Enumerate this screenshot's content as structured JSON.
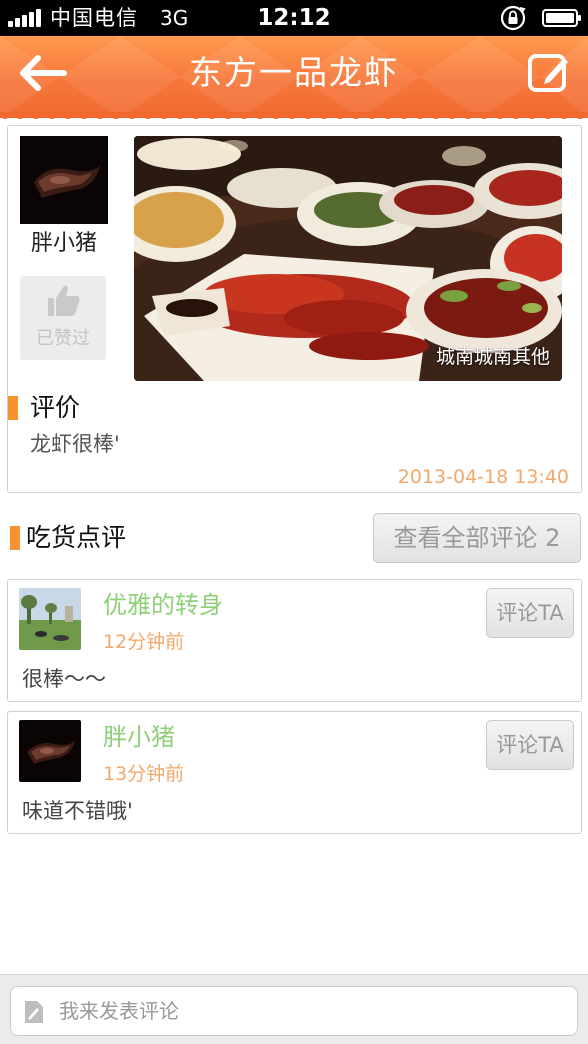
{
  "status_bar": {
    "carrier": "中国电信",
    "network": "3G",
    "time": "12:12"
  },
  "nav": {
    "title": "东方一品龙虾",
    "back_icon": "arrow-left-icon",
    "edit_icon": "edit-icon",
    "color": "#f7773b"
  },
  "post": {
    "author": "胖小猪",
    "like_label": "已赞过",
    "photo_caption": "城南城南其他",
    "review_heading": "评价",
    "review_text": "龙虾很棒'",
    "timestamp": "2013-04-18 13:40"
  },
  "comments_section": {
    "heading": "吃货点评",
    "view_all_label": "查看全部评论 2"
  },
  "comments": [
    {
      "name": "优雅的转身",
      "time": "12分钟前",
      "text": "很棒～～",
      "reply_label": "评论TA"
    },
    {
      "name": "胖小猪",
      "time": "13分钟前",
      "text": "味道不错哦'",
      "reply_label": "评论TA"
    }
  ],
  "composer": {
    "placeholder": "我来发表评论"
  }
}
